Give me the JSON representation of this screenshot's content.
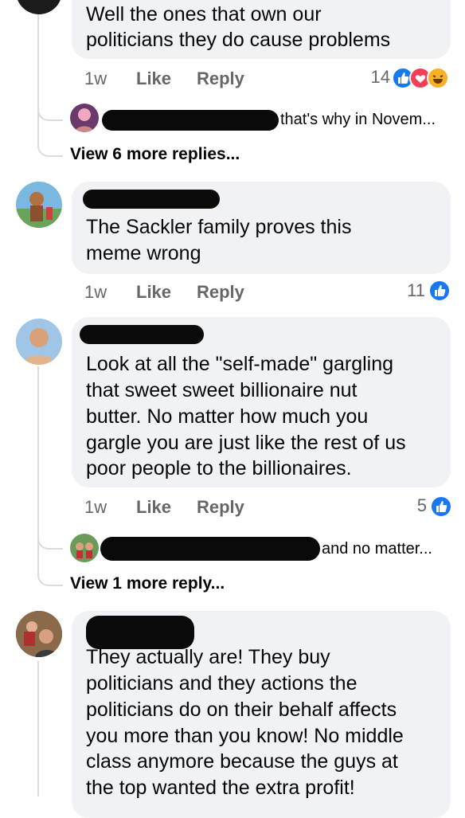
{
  "comments": [
    {
      "text_lines": [
        "Well the ones that own our",
        "politicians they do  cause  problems"
      ],
      "time": "1w",
      "like": "Like",
      "reply": "Reply",
      "reactions": "14",
      "reaction_icons": [
        "like-icon",
        "love-icon",
        "haha-icon"
      ]
    },
    {
      "text_lines": [
        "The Sackler family proves this",
        "meme wrong"
      ],
      "time": "1w",
      "like": "Like",
      "reply": "Reply",
      "reactions": "11",
      "reaction_icons": [
        "like-icon"
      ]
    },
    {
      "text_lines": [
        "Look at all the \"self-made\" gargling",
        "that sweet sweet billionaire nut",
        "butter. No matter how much you",
        "gargle you are just like the rest of us",
        "poor people to the billionaires."
      ],
      "time": "1w",
      "like": "Like",
      "reply": "Reply",
      "reactions": "5",
      "reaction_icons": [
        "like-icon"
      ]
    },
    {
      "text_lines": [
        "They actually are! They buy",
        "politicians and they actions the",
        "politicians do on their behalf affects",
        "you more than you know! No middle",
        "class anymore because the guys at",
        "the top wanted the extra profit!"
      ]
    }
  ],
  "replies": [
    {
      "preview": "that's why in Novem...",
      "view_more": "View 6 more replies..."
    },
    {
      "preview": "and no matter...",
      "view_more": "View 1 more reply..."
    }
  ],
  "colors": {
    "like_blue": "#1877f2",
    "love_red": "#f33e58",
    "haha_yellow": "#f7b125",
    "bubble": "#f0f2f5",
    "meta_gray": "#65676b"
  }
}
